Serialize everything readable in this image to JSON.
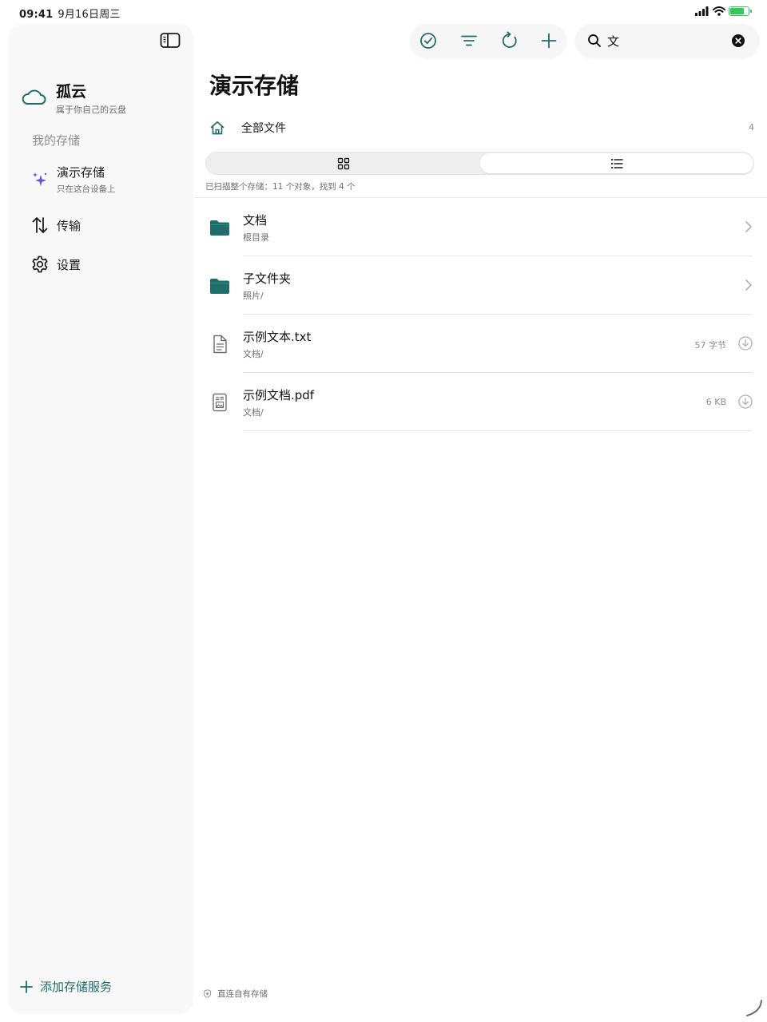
{
  "status": {
    "time": "09:41",
    "date": "9月16日周三"
  },
  "sidebar": {
    "brand_title": "孤云",
    "brand_subtitle": "属于你自己的云盘",
    "section_label": "我的存储",
    "storage_item": {
      "label": "演示存储",
      "sublabel": "只在这台设备上"
    },
    "transfer_label": "传输",
    "settings_label": "设置",
    "add_storage_label": "添加存储服务"
  },
  "search": {
    "value": "文"
  },
  "main": {
    "title": "演示存储",
    "breadcrumb_label": "全部文件",
    "breadcrumb_count": "4",
    "view_mode": "list",
    "scan_note": "已扫描整个存储：11 个对象，找到 4 个",
    "files": [
      {
        "name": "文档",
        "path": "根目录",
        "kind": "folder"
      },
      {
        "name": "子文件夹",
        "path": "照片/",
        "kind": "folder"
      },
      {
        "name": "示例文本.txt",
        "path": "文档/",
        "kind": "text",
        "size": "57 字节"
      },
      {
        "name": "示例文档.pdf",
        "path": "文档/",
        "kind": "pdf",
        "size": "6 KB"
      }
    ],
    "footer_note": "直连自有存储"
  },
  "colors": {
    "accent": "#1f6e6c",
    "folder": "#1f6e6c",
    "sparkle": "#6a4fd8"
  },
  "icons": [
    "sidebar-toggle-icon",
    "cloud-icon",
    "sparkle-icon",
    "transfer-icon",
    "gear-icon",
    "plus-icon",
    "checkmark-circle-icon",
    "filter-icon",
    "refresh-icon",
    "search-icon",
    "clear-icon",
    "home-icon",
    "grid-icon",
    "list-icon",
    "folder-icon",
    "document-icon",
    "pdf-icon",
    "chevron-right-icon",
    "download-icon",
    "shield-icon",
    "spinner-icon"
  ]
}
